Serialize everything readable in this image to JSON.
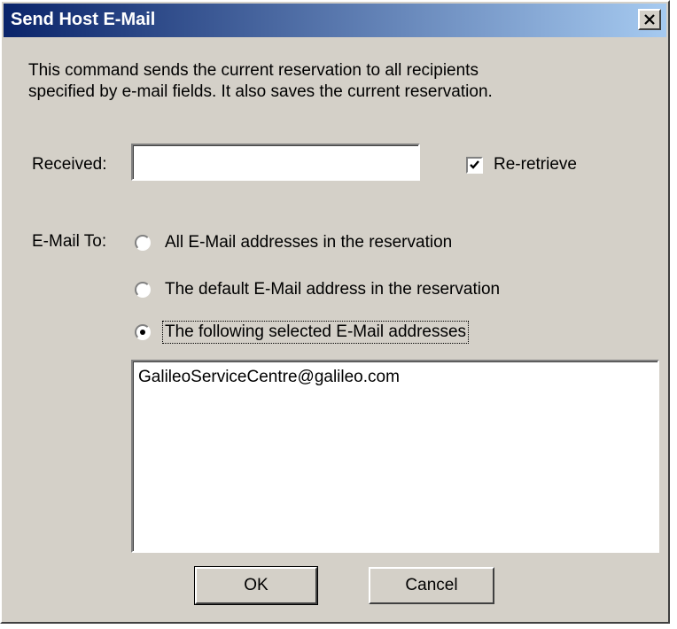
{
  "window": {
    "title": "Send Host E-Mail",
    "title_gradient_start": "#0a246a",
    "title_gradient_end": "#a6caf0"
  },
  "description": "This command sends the current reservation to all recipients\nspecified by e-mail fields.  It also saves the current reservation.",
  "received": {
    "label": "Received:",
    "value": "",
    "placeholder": ""
  },
  "reretrieve": {
    "label": "Re-retrieve",
    "checked": true
  },
  "email_to": {
    "label": "E-Mail To:",
    "options": [
      {
        "label": "All E-Mail addresses in the reservation",
        "selected": false
      },
      {
        "label": "The default E-Mail address in the reservation",
        "selected": false
      },
      {
        "label": "The following selected E-Mail addresses",
        "selected": true
      }
    ]
  },
  "addresses": [
    "GalileoServiceCentre@galileo.com"
  ],
  "buttons": {
    "ok_label": "OK",
    "cancel_label": "Cancel"
  },
  "icons": {
    "close": "close-icon",
    "check": "checkmark-icon"
  }
}
